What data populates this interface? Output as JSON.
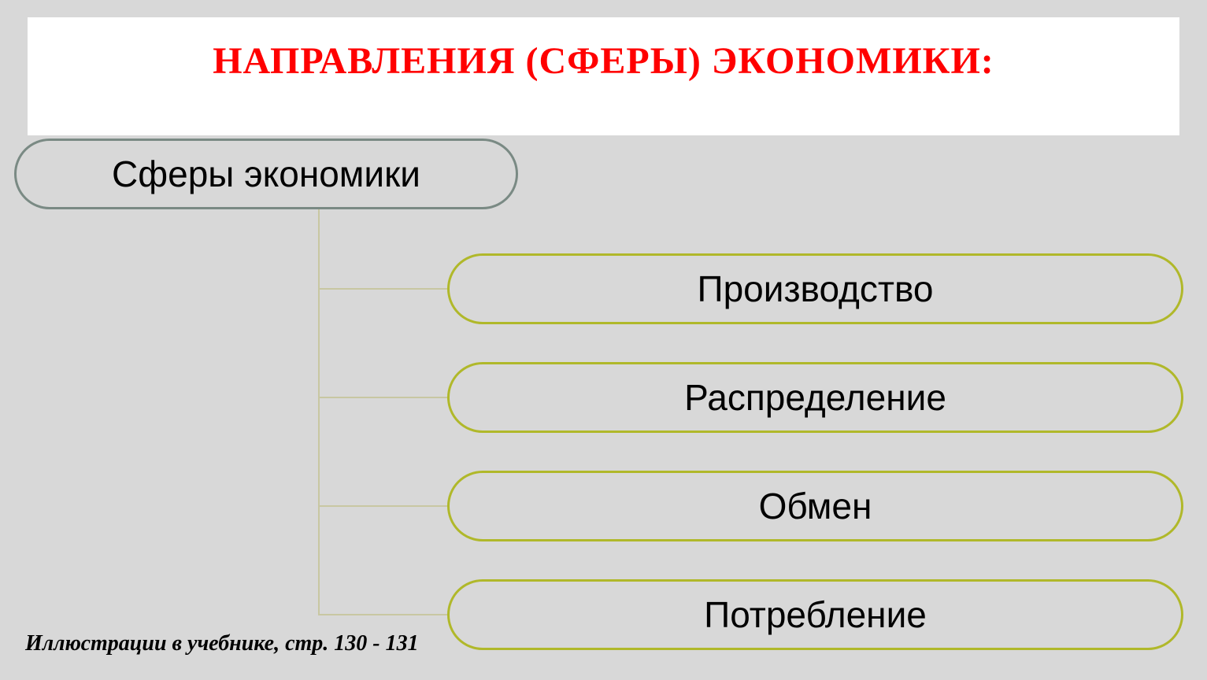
{
  "title": "НАПРАВЛЕНИЯ (СФЕРЫ) ЭКОНОМИКИ:",
  "root": "Сферы экономики",
  "children": [
    "Производство",
    "Распределение",
    "Обмен",
    "Потребление"
  ],
  "footer": "Иллюстрации в учебнике, стр. 130 - 131"
}
